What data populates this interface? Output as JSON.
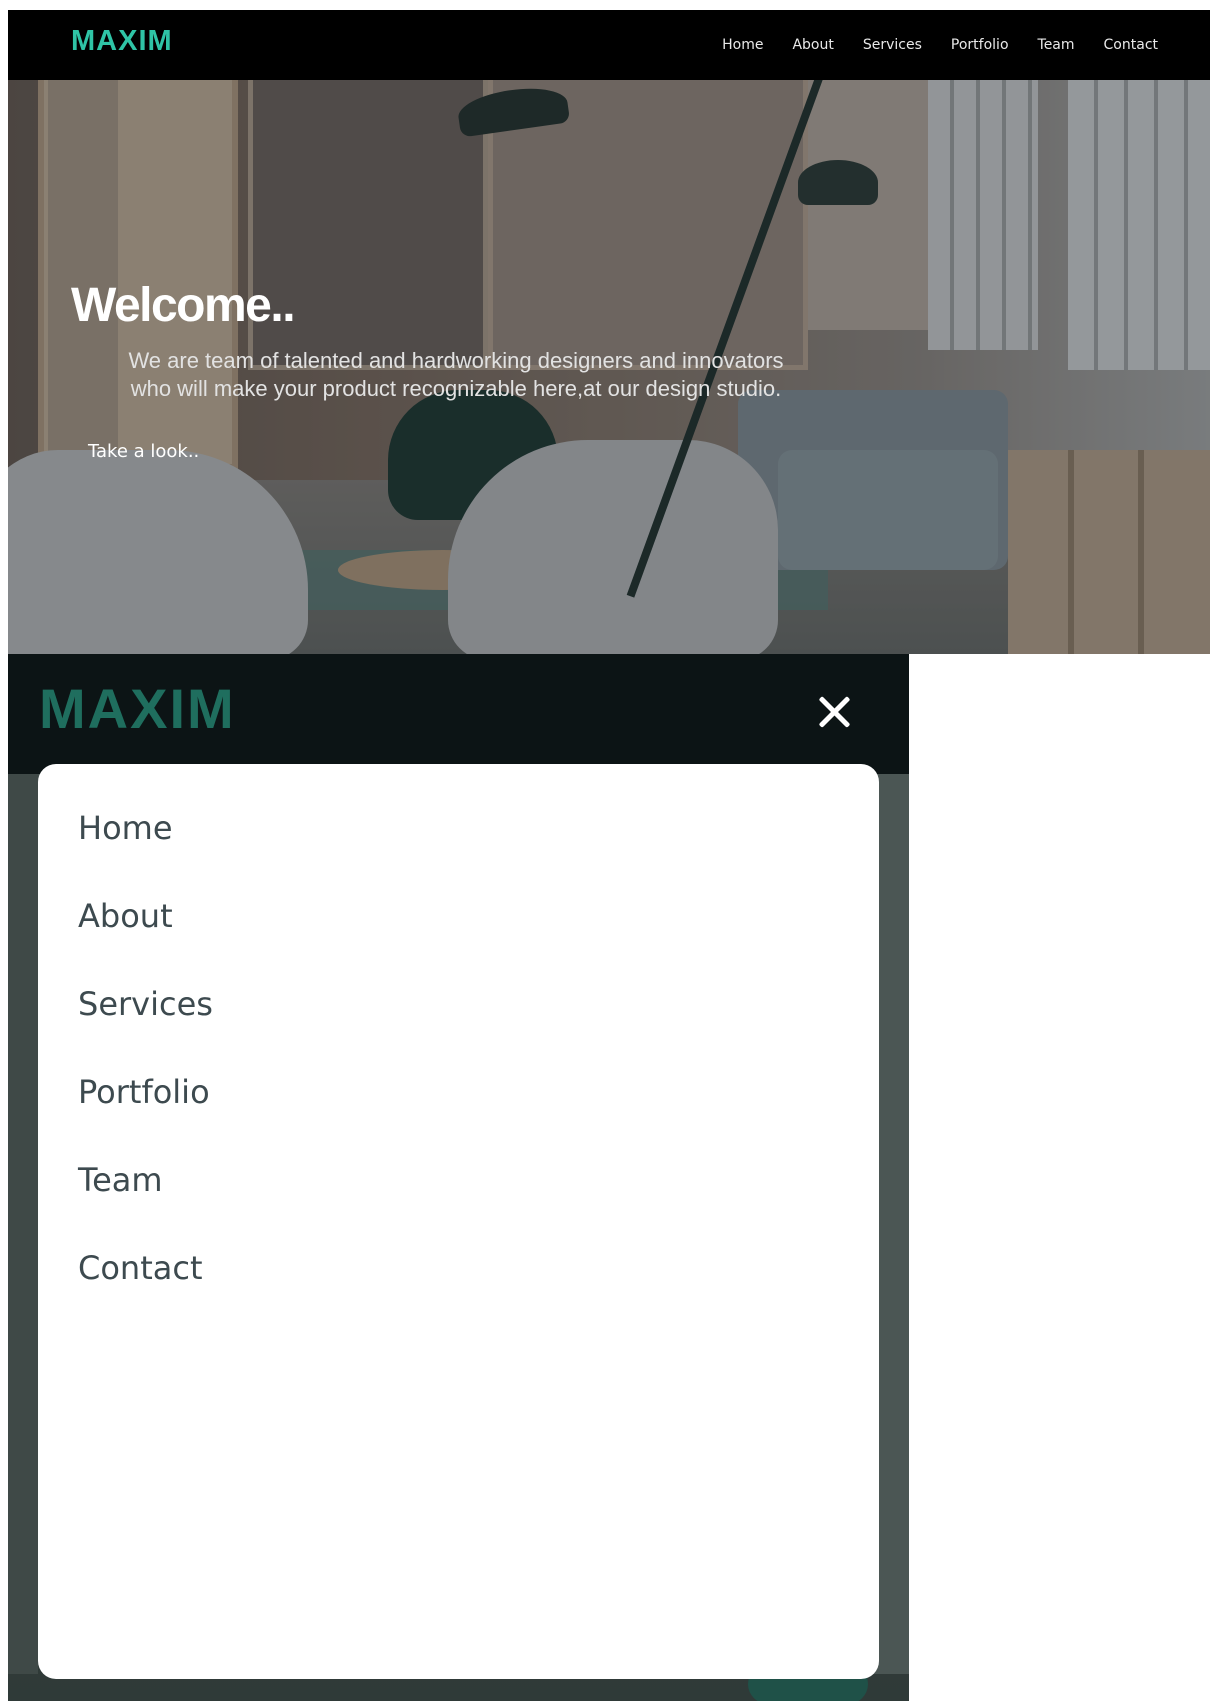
{
  "desktop": {
    "logo": "MAXIM",
    "nav": [
      "Home",
      "About",
      "Services",
      "Portfolio",
      "Team",
      "Contact"
    ],
    "hero": {
      "title": "Welcome..",
      "subtitle_line1": "We are team of talented and hardworking designers and innovators",
      "subtitle_line2": "who will make your product recognizable here,at our design studio.",
      "cta": "Take a look.."
    }
  },
  "mobile": {
    "logo": "MAXIM",
    "close_icon": "close-icon",
    "menu": [
      "Home",
      "About",
      "Services",
      "Portfolio",
      "Team",
      "Contact"
    ]
  },
  "colors": {
    "accent": "#2fc4a6",
    "accent_dark": "#1f6e5e",
    "nav_bg": "#000000",
    "mobile_header_bg": "#0c1415"
  }
}
